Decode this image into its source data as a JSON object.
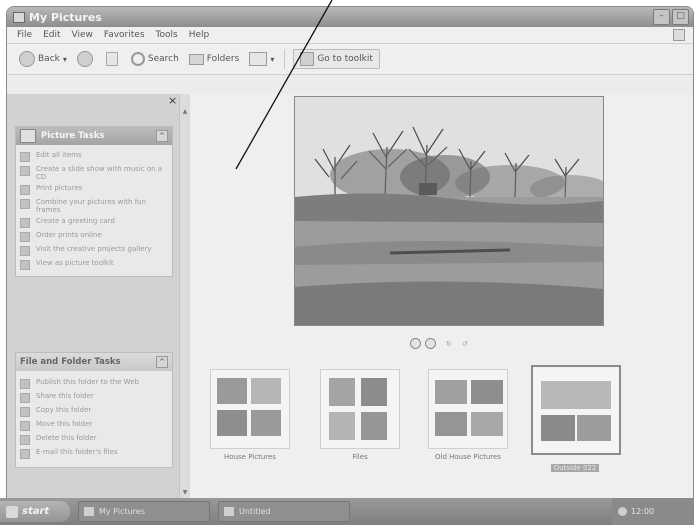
{
  "window": {
    "title": "My Pictures"
  },
  "menu": [
    "File",
    "Edit",
    "View",
    "Favorites",
    "Tools",
    "Help"
  ],
  "toolbar": {
    "back": "Back",
    "search": "Search",
    "folders": "Folders",
    "toolkit": "Go to toolkit"
  },
  "picture_tasks": {
    "title": "Picture Tasks",
    "items": [
      "Edit all items",
      "Create a slide show with music on a CD",
      "Print pictures",
      "Combine your pictures with fun frames",
      "Create a greeting card",
      "Order prints online",
      "Visit the creative projects gallery",
      "View as picture toolkit"
    ]
  },
  "file_tasks": {
    "title": "File and Folder Tasks",
    "items": [
      "Publish this folder to the Web",
      "Share this folder",
      "Copy this folder",
      "Move this folder",
      "Delete this folder",
      "E-mail this folder's files"
    ]
  },
  "thumbnails": [
    {
      "label": "House Pictures"
    },
    {
      "label": "Files"
    },
    {
      "label": "Old House Pictures"
    },
    {
      "label": "Outside 022"
    }
  ],
  "taskbar": {
    "start": "start",
    "buttons": [
      "My Pictures",
      "Untitled"
    ],
    "clock": "12:00"
  },
  "colors": {
    "title_bar": "#9d9d9d",
    "left_pane": "#d2d2d2",
    "taskbar": "#8c8c8c"
  }
}
